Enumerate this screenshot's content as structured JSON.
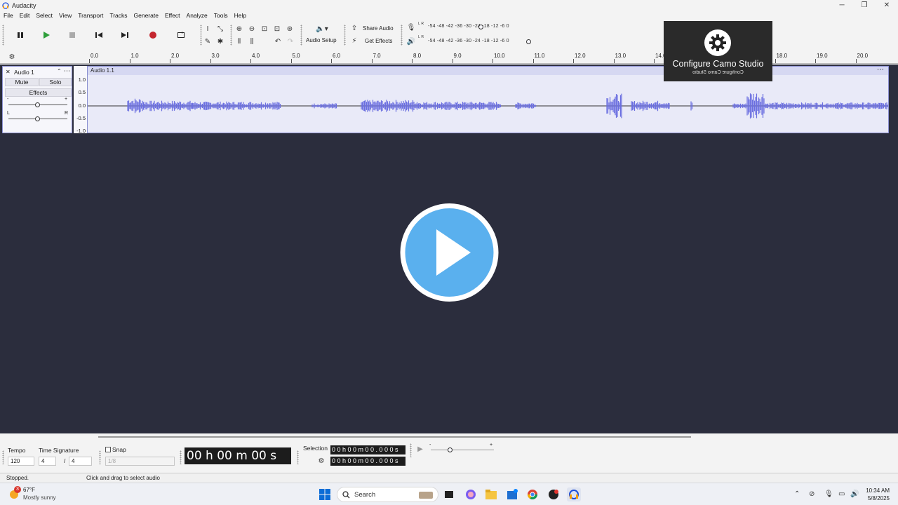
{
  "window": {
    "title": "Audacity",
    "minimize": "─",
    "maximize": "❐",
    "close": "✕"
  },
  "menu": [
    "File",
    "Edit",
    "Select",
    "View",
    "Transport",
    "Tracks",
    "Generate",
    "Effect",
    "Analyze",
    "Tools",
    "Help"
  ],
  "toolbar": {
    "audio_setup_label": "Audio Setup",
    "share_audio_label": "Share Audio",
    "get_effects_label": "Get Effects",
    "meter_scale_record": "-54  -48  -42  -36  -30  -24  -18  -12   -6    0",
    "meter_scale_play": "-54  -48  -42  -36  -30  -24  -18  -12   -6    0",
    "meter_lr_top": "L R",
    "meter_lr_bottom": "L R"
  },
  "ruler": {
    "ticks": [
      "0.0",
      "1.0",
      "2.0",
      "3.0",
      "4.0",
      "5.0",
      "6.0",
      "7.0",
      "8.0",
      "9.0",
      "10.0",
      "11.0",
      "12.0",
      "13.0",
      "14.0",
      "",
      "",
      "18.0",
      "19.0",
      "20.0"
    ]
  },
  "track": {
    "name": "Audio 1",
    "mute": "Mute",
    "solo": "Solo",
    "effects": "Effects",
    "gain_minus": "-",
    "gain_plus": "+",
    "pan_left": "L",
    "pan_right": "R",
    "clip_title": "Audio 1.1",
    "amplitude": [
      "1.0",
      "0.5",
      "0.0",
      "-0.5",
      "-1.0"
    ]
  },
  "overlay": {
    "camo_title": "Configure Camo Studio",
    "camo_sub": "Configure Camo Studio"
  },
  "bottom": {
    "tempo_label": "Tempo",
    "tempo_value": "120",
    "time_signature_label": "Time Signature",
    "ts_num": "4",
    "ts_sep": "/",
    "ts_den": "4",
    "snap_label": "Snap",
    "snap_value": "1/8",
    "time_display": "00 h 00 m 00 s",
    "selection_label": "Selection",
    "selection_start": "0 0 h 0 0 m 0 0 . 0 0 0 s",
    "selection_end": "0 0 h 0 0 m 0 0 . 0 0 0 s",
    "speed_minus": "-",
    "speed_plus": "+"
  },
  "status": {
    "left": "Stopped.",
    "hint": "Click and drag to select audio"
  },
  "taskbar": {
    "weather_temp": "67°F",
    "weather_desc": "Mostly sunny",
    "weather_badge": "3",
    "search_text": "Search",
    "time": "10:34 AM",
    "date": "5/8/2025"
  },
  "colors": {
    "waveform": "#6b6fe0",
    "track_bg": "#2b2d3d",
    "accent": "#5ab0ee"
  }
}
